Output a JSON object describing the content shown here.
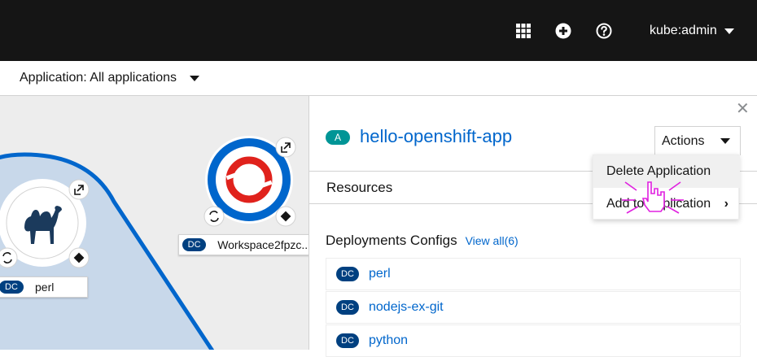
{
  "masthead": {
    "icons": [
      "grid-icon",
      "plus-circle-icon",
      "help-icon"
    ],
    "user": "kube:admin"
  },
  "app_selector": {
    "label": "Application: All applications"
  },
  "topology": {
    "nodes": [
      {
        "name": "perl",
        "kind": "DC",
        "icon": "camel-icon"
      },
      {
        "name": "Workspace2fpzc...",
        "kind": "DC",
        "icon": "openshift-icon"
      }
    ]
  },
  "panel": {
    "badge": "A",
    "title": "hello-openshift-app",
    "actions_label": "Actions",
    "tab_resources": "Resources",
    "section_title": "Deployments Configs",
    "view_all": "View all(6)",
    "resources": [
      {
        "kind": "DC",
        "name": "perl"
      },
      {
        "kind": "DC",
        "name": "nodejs-ex-git"
      },
      {
        "kind": "DC",
        "name": "python"
      }
    ]
  },
  "dropdown": {
    "items": [
      "Delete Application",
      "Add to Application"
    ]
  },
  "colors": {
    "masthead": "#151515",
    "link": "#0066cc",
    "app_badge": "#009596",
    "dc_badge": "#004080",
    "group_fill": "#c8d8ea",
    "group_stroke": "#0066cc"
  }
}
